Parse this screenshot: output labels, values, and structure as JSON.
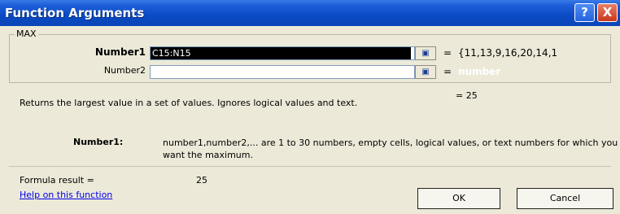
{
  "window": {
    "title": "Function Arguments",
    "help_button": "?",
    "close_button": "X"
  },
  "group": {
    "legend": "MAX",
    "args": [
      {
        "label": "Number1",
        "value": "C15:N15",
        "result": "{11,13,9,16,20,14,1"
      },
      {
        "label": "Number2",
        "value": "",
        "result": "",
        "hint": "number"
      }
    ],
    "equals_sign": "=",
    "ref_icon": "range-select-icon"
  },
  "function": {
    "result": "= 25",
    "description": "Returns the largest value in a set of values. Ignores logical values and text."
  },
  "argument_help": {
    "name": "Number1:",
    "text": "number1,number2,... are 1 to 30 numbers, empty cells, logical values, or text numbers for which you want the maximum."
  },
  "formula": {
    "label": "Formula result =",
    "value": "25"
  },
  "help_link": "Help on this function",
  "buttons": {
    "ok": "OK",
    "cancel": "Cancel"
  }
}
